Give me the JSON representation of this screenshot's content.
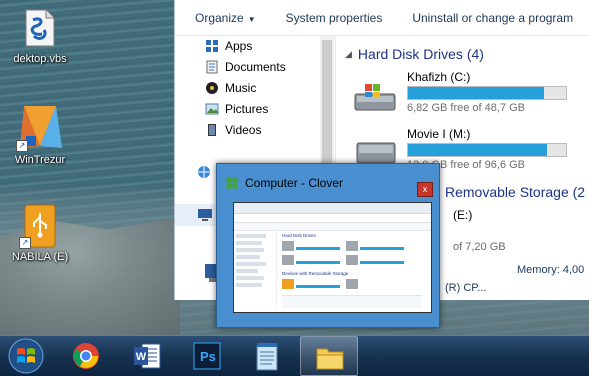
{
  "desktop": {
    "icons": [
      {
        "label": "dektop.vbs",
        "icon": "vbs-script-icon"
      },
      {
        "label": "WinTrezur",
        "icon": "wintrezur-app-icon"
      },
      {
        "label": "NABILA (E)",
        "icon": "usb-drive-icon"
      }
    ]
  },
  "explorer": {
    "toolbar": {
      "organize": "Organize",
      "system_properties": "System properties",
      "uninstall": "Uninstall or change a program"
    },
    "nav": [
      {
        "label": "Apps",
        "icon": "apps-icon"
      },
      {
        "label": "Documents",
        "icon": "documents-icon"
      },
      {
        "label": "Music",
        "icon": "music-icon"
      },
      {
        "label": "Pictures",
        "icon": "pictures-icon"
      },
      {
        "label": "Videos",
        "icon": "videos-icon"
      }
    ],
    "hard_disk_header": "Hard Disk Drives (4)",
    "drives": [
      {
        "name": "Khafizh (C:)",
        "free": "6,82 GB free of 48,7 GB",
        "used_fraction": 0.86
      },
      {
        "name": "Movie I (M:)",
        "free": "12,0 GB free of 96,6 GB",
        "used_fraction": 0.88
      }
    ],
    "removable_header": "Removable Storage (2",
    "removable_drive_label": "(E:)",
    "removable_free": "of 7,20 GB",
    "memory": "Memory: 4,00",
    "cpu": "(R) CP..."
  },
  "preview": {
    "title": "Computer - Clover",
    "close_glyph": "x",
    "thumbnail": {
      "section_hdd": "Hard Disk Drives",
      "section_removable": "Devices with Removable Storage"
    }
  },
  "taskbar": {
    "items": [
      {
        "name": "start-button",
        "icon": "windows-start-icon"
      },
      {
        "name": "chrome",
        "icon": "chrome-icon"
      },
      {
        "name": "word",
        "icon": "word-icon"
      },
      {
        "name": "photoshop",
        "icon": "photoshop-icon",
        "text": "Ps"
      },
      {
        "name": "notepad",
        "icon": "notepad-icon"
      },
      {
        "name": "explorer",
        "icon": "folder-icon"
      }
    ]
  }
}
